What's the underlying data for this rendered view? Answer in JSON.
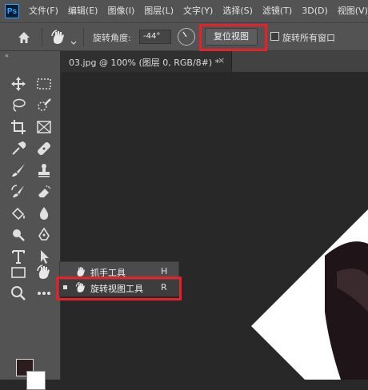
{
  "app": {
    "logo": "Ps"
  },
  "menu": [
    "文件(F)",
    "编辑(E)",
    "图像(I)",
    "图层(L)",
    "文字(Y)",
    "选择(S)",
    "滤镜(T)",
    "3D(D)",
    "视图(V)"
  ],
  "options": {
    "angle_label": "旋转角度:",
    "angle_value": "-44°",
    "reset_label": "复位视图",
    "rotate_all_label": "旋转所有窗口",
    "rotate_all_checked": false
  },
  "panel": {
    "collapse": "«"
  },
  "document": {
    "tab_title": "03.jpg @ 100% (图层 0, RGB/8#) *",
    "close": "×"
  },
  "flyout": [
    {
      "label": "抓手工具",
      "shortcut": "H",
      "active": false
    },
    {
      "label": "旋转视图工具",
      "shortcut": "R",
      "active": true
    }
  ],
  "colors": {
    "foreground": "#2d1c1e",
    "background": "#ffffff",
    "highlight": "#e8202a"
  },
  "icons": [
    "home-icon",
    "rotate-view-icon",
    "move-icon",
    "marquee-icon",
    "lasso-icon",
    "quick-select-icon",
    "crop-icon",
    "frame-icon",
    "eyedropper-icon",
    "healing-icon",
    "brush-icon",
    "stamp-icon",
    "history-brush-icon",
    "eraser-icon",
    "bucket-icon",
    "blur-icon",
    "dodge-icon",
    "pen-icon",
    "type-icon",
    "path-select-icon",
    "rectangle-icon",
    "hand-icon",
    "zoom-icon",
    "more-icon"
  ]
}
